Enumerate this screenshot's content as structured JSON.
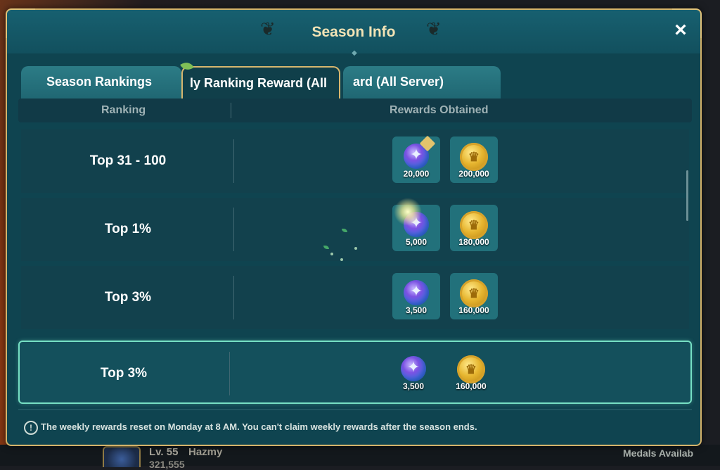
{
  "window": {
    "title": "Season Info",
    "close_icon": "×"
  },
  "tabs": [
    {
      "label": "Season Rankings",
      "active": false
    },
    {
      "label": "ly Ranking Reward (All",
      "active": true
    },
    {
      "label": "ard (All Server)",
      "active": false
    }
  ],
  "table": {
    "headers": {
      "ranking": "Ranking",
      "rewards": "Rewards Obtained"
    },
    "rows": [
      {
        "rank": "Top 31 - 100",
        "gem_amount": "20,000",
        "coin_amount": "200,000"
      },
      {
        "rank": "Top 1%",
        "gem_amount": "5,000",
        "coin_amount": "180,000"
      },
      {
        "rank": "Top 3%",
        "gem_amount": "3,500",
        "coin_amount": "160,000"
      }
    ],
    "current": {
      "rank": "Top 3%",
      "gem_amount": "3,500",
      "coin_amount": "160,000"
    }
  },
  "icons": {
    "gem": "crystal-gem-icon",
    "coin": "gold-coin-icon",
    "info": "info-icon",
    "gem_glyph": "✦",
    "coin_glyph": "♛",
    "info_glyph": "!"
  },
  "footer": {
    "text": "The weekly rewards reset on Monday at 8 AM. You can't claim weekly rewards after the season ends."
  },
  "hud": {
    "level": "Lv. 55",
    "name": "Hazmy",
    "power": "321,555",
    "medals": "Medals Availab"
  },
  "colors": {
    "panel": "#0f4450",
    "gold_border": "#d4b36a",
    "highlight": "#76e0c4",
    "title": "#f2e3b5"
  }
}
